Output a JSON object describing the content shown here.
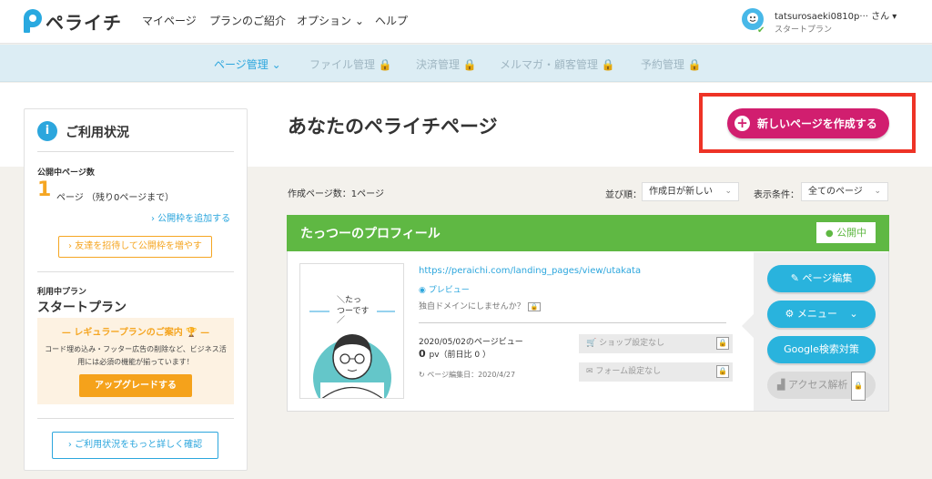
{
  "header": {
    "logo_text": "ペライチ",
    "nav": [
      "マイページ",
      "プランのご紹介",
      "オプション ⌄",
      "ヘルプ"
    ],
    "user_name": "tatsurosaeki0810p··· さん ▾",
    "user_plan": "スタートプラン"
  },
  "subnav": {
    "items": [
      {
        "label": "ページ管理 ⌄",
        "locked": false
      },
      {
        "label": "ファイル管理 🔒",
        "locked": true
      },
      {
        "label": "決済管理 🔒",
        "locked": true
      },
      {
        "label": "メルマガ・顧客管理 🔒",
        "locked": true
      },
      {
        "label": "予約管理 🔒",
        "locked": true
      }
    ]
  },
  "main": {
    "title": "あなたのペライチページ",
    "create_button": "新しいページを作成する",
    "created_count": "作成ページ数：1ページ",
    "sort_label": "並び順：",
    "sort_value": "作成日が新しい",
    "filter_label": "表示条件：",
    "filter_value": "全てのページ"
  },
  "sidebar": {
    "title": "ご利用状況",
    "public_pages_label": "公開中ページ数",
    "page_count": "1",
    "page_count_text": "ページ （残り0ページまで）",
    "add_slot_link": "› 公開枠を追加する",
    "invite_button": "› 友達を招待して公開枠を増やす",
    "plan_label": "利用中プラン",
    "plan_name": "スタートプラン",
    "promo_title": "— レギュラープランのご案内 🏆 —",
    "promo_body": "コード埋め込み・フッター広告の削除など、ビジネス活用には必須の機能が揃っています！",
    "upgrade_button": "アップグレードする",
    "details_button": "› ご利用状況をもっと詳しく確認"
  },
  "card": {
    "title": "たっつーのプロフィール",
    "status": "公開中",
    "thumb_text_1": "＼たっ",
    "thumb_text_2": "つーです",
    "url": "https://peraichi.com/landing_pages/view/utakata",
    "preview": "プレビュー",
    "domain_question": "独自ドメインにしませんか？",
    "pv_date": "2020/05/02のページビュー",
    "pv_count": "0",
    "pv_unit": "pv（前日比 0 ）",
    "edit_date": "ページ編集日：2020/4/27",
    "shop_setting": "ショップ設定なし",
    "form_setting": "フォーム設定なし",
    "actions": {
      "edit": "ページ編集",
      "menu": "メニュー",
      "seo": "Google検索対策",
      "analytics": "アクセス解析"
    }
  },
  "colors": {
    "accent_blue": "#2ca6dd",
    "brand_magenta": "#d11e6f",
    "card_green": "#5fb843",
    "orange": "#f5a623",
    "highlight_red": "#ee3326"
  }
}
